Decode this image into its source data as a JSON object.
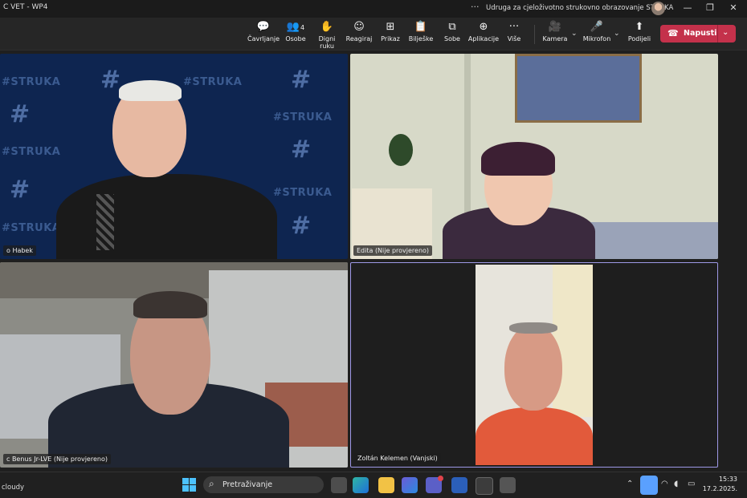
{
  "window": {
    "title": "C VET - WP4",
    "more": "···",
    "organization": "Udruga za cjeloživotno strukovno obrazovanje STRUKA",
    "controls": {
      "minimize": "—",
      "restore": "❐",
      "close": "✕"
    }
  },
  "toolbar": {
    "items": [
      {
        "label": "Čavrljanje",
        "icon": "chat-icon",
        "glyph": "💬"
      },
      {
        "label": "Osobe",
        "icon": "people-icon",
        "glyph": "👥",
        "count": "4"
      },
      {
        "label": "Digni ruku",
        "icon": "raise-hand-icon",
        "glyph": "✋"
      },
      {
        "label": "Reagiraj",
        "icon": "smiley-icon",
        "glyph": "☺"
      },
      {
        "label": "Prikaz",
        "icon": "grid-view-icon",
        "glyph": "⊞"
      },
      {
        "label": "Bilješke",
        "icon": "notes-icon",
        "glyph": "📋"
      },
      {
        "label": "Sobe",
        "icon": "rooms-icon",
        "glyph": "⧉"
      },
      {
        "label": "Aplikacije",
        "icon": "apps-plus-icon",
        "glyph": "⊕"
      },
      {
        "label": "Više",
        "icon": "more-icon",
        "glyph": "···"
      },
      {
        "label": "Kamera",
        "icon": "camera-icon",
        "glyph": "🎥"
      },
      {
        "label": "Mikrofon",
        "icon": "microphone-icon",
        "glyph": "🎤"
      },
      {
        "label": "Podijeli",
        "icon": "share-icon",
        "glyph": "⬆"
      }
    ],
    "chevron": "⌄",
    "leave_label": "Napusti",
    "leave_color": "#c4314b"
  },
  "participants": [
    {
      "name": "o Habek",
      "background_text": "#STRUKA"
    },
    {
      "name": "Edita (Nije provjereno)"
    },
    {
      "name": "c Benus Jr-LVE (Nije provjereno)"
    },
    {
      "name": "Zoltán Kelemen (Vanjski)",
      "active_speaker": true,
      "active_border_color": "#9e98e6"
    }
  ],
  "taskbar": {
    "weather_text": "cloudy",
    "search_placeholder": "Pretraživanje",
    "search_icon": "⌕",
    "tray_chevron": "⌃",
    "time": "15:33",
    "date": "17.2.2025."
  }
}
